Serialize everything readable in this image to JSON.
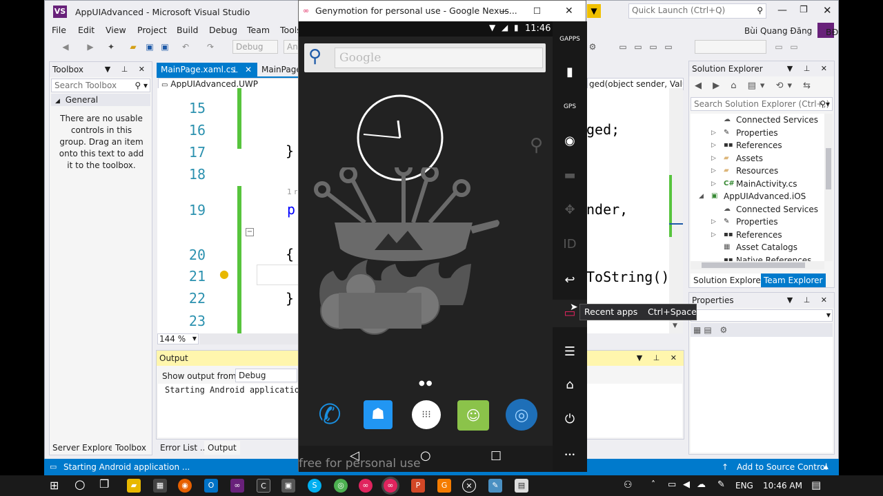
{
  "vs": {
    "title": "AppUIAdvanced - Microsoft Visual Studio",
    "quick_launch_placeholder": "Quick Launch (Ctrl+Q)",
    "user_name": "Bùi Quang Đăng",
    "user_initials": "BĐ",
    "menu": [
      "File",
      "Edit",
      "View",
      "Project",
      "Build",
      "Debug",
      "Team",
      "Tools"
    ],
    "toolbar": {
      "config": "Debug",
      "platform": "Any"
    },
    "toolbox": {
      "title": "Toolbox",
      "search_placeholder": "Search Toolbox",
      "group": "General",
      "empty_message": "There are no usable controls in this group. Drag an item onto this text to add it to the toolbox."
    },
    "doc_tabs": [
      {
        "label": "MainPage.xaml.cs"
      },
      {
        "label": "MainPage."
      }
    ],
    "nav_project": "AppUIAdvanced.UWP",
    "nav_member": "ged(object sender, Valu",
    "code": {
      "line_numbers": [
        "15",
        "16",
        "17",
        "18",
        "19",
        "20",
        "21",
        "22",
        "23"
      ],
      "refs_hint": "1 r",
      "left_fragments": [
        "}",
        "p",
        "{",
        "}"
      ],
      "right_fragments": [
        "ged;",
        "nder,",
        "ToString();"
      ]
    },
    "zoom": "144 %",
    "output": {
      "title": "Output",
      "show_from_label": "Show output from:",
      "source": "Debug",
      "text": "Starting Android application"
    },
    "bottom_tabs_left": [
      "Server Explorer",
      "Toolbox"
    ],
    "bottom_tabs_mid": [
      "Error List ...",
      "Output"
    ],
    "solution_explorer": {
      "title": "Solution Explorer",
      "search_placeholder": "Search Solution Explorer (Ctrl+;)",
      "items": [
        {
          "label": "Connected Services",
          "indent": 2,
          "arrow": "",
          "icon": "cloud-icon"
        },
        {
          "label": "Properties",
          "indent": 2,
          "arrow": "▷",
          "icon": "wrench-icon"
        },
        {
          "label": "References",
          "indent": 2,
          "arrow": "▷",
          "icon": "references-icon"
        },
        {
          "label": "Assets",
          "indent": 2,
          "arrow": "▷",
          "icon": "folder-icon"
        },
        {
          "label": "Resources",
          "indent": 2,
          "arrow": "▷",
          "icon": "folder-icon"
        },
        {
          "label": "MainActivity.cs",
          "indent": 2,
          "arrow": "▷",
          "icon": "csharp-icon"
        },
        {
          "label": "AppUIAdvanced.iOS",
          "indent": 1,
          "arrow": "◢",
          "icon": "project-icon"
        },
        {
          "label": "Connected Services",
          "indent": 2,
          "arrow": "",
          "icon": "cloud-icon"
        },
        {
          "label": "Properties",
          "indent": 2,
          "arrow": "▷",
          "icon": "wrench-icon"
        },
        {
          "label": "References",
          "indent": 2,
          "arrow": "▷",
          "icon": "references-icon"
        },
        {
          "label": "Asset Catalogs",
          "indent": 2,
          "arrow": "",
          "icon": "catalog-icon"
        },
        {
          "label": "Native References",
          "indent": 2,
          "arrow": "",
          "icon": "references-icon"
        }
      ],
      "tabs": [
        "Solution Explorer",
        "Team Explorer"
      ]
    },
    "properties": {
      "title": "Properties"
    },
    "status": {
      "message": "Starting Android application ...",
      "source_control": "Add to Source Control"
    }
  },
  "genymotion": {
    "title": "Genymotion for personal use - Google Nexus...",
    "status_time": "11:46",
    "search_placeholder": "Google",
    "watermark": "free for personal use",
    "side_buttons": [
      {
        "name": "gapps-icon",
        "label": "GAPPS"
      },
      {
        "name": "battery-icon",
        "label": "▮"
      },
      {
        "name": "gps-icon",
        "label": "GPS"
      },
      {
        "name": "camera-icon",
        "label": "◉"
      },
      {
        "name": "capture-icon",
        "label": "▬"
      },
      {
        "name": "move-icon",
        "label": "✥"
      },
      {
        "name": "id-icon",
        "label": "ID"
      },
      {
        "name": "back-icon",
        "label": "↩"
      },
      {
        "name": "recent-apps-icon",
        "label": "▭"
      },
      {
        "name": "menu-icon",
        "label": "☰"
      },
      {
        "name": "home-icon",
        "label": "⌂"
      },
      {
        "name": "power-icon",
        "label": "⏻"
      },
      {
        "name": "more-icon",
        "label": "•••"
      }
    ],
    "tooltip": {
      "label": "Recent apps",
      "shortcut": "Ctrl+Space"
    }
  },
  "taskbar": {
    "lang": "ENG",
    "time": "10:46 AM"
  }
}
